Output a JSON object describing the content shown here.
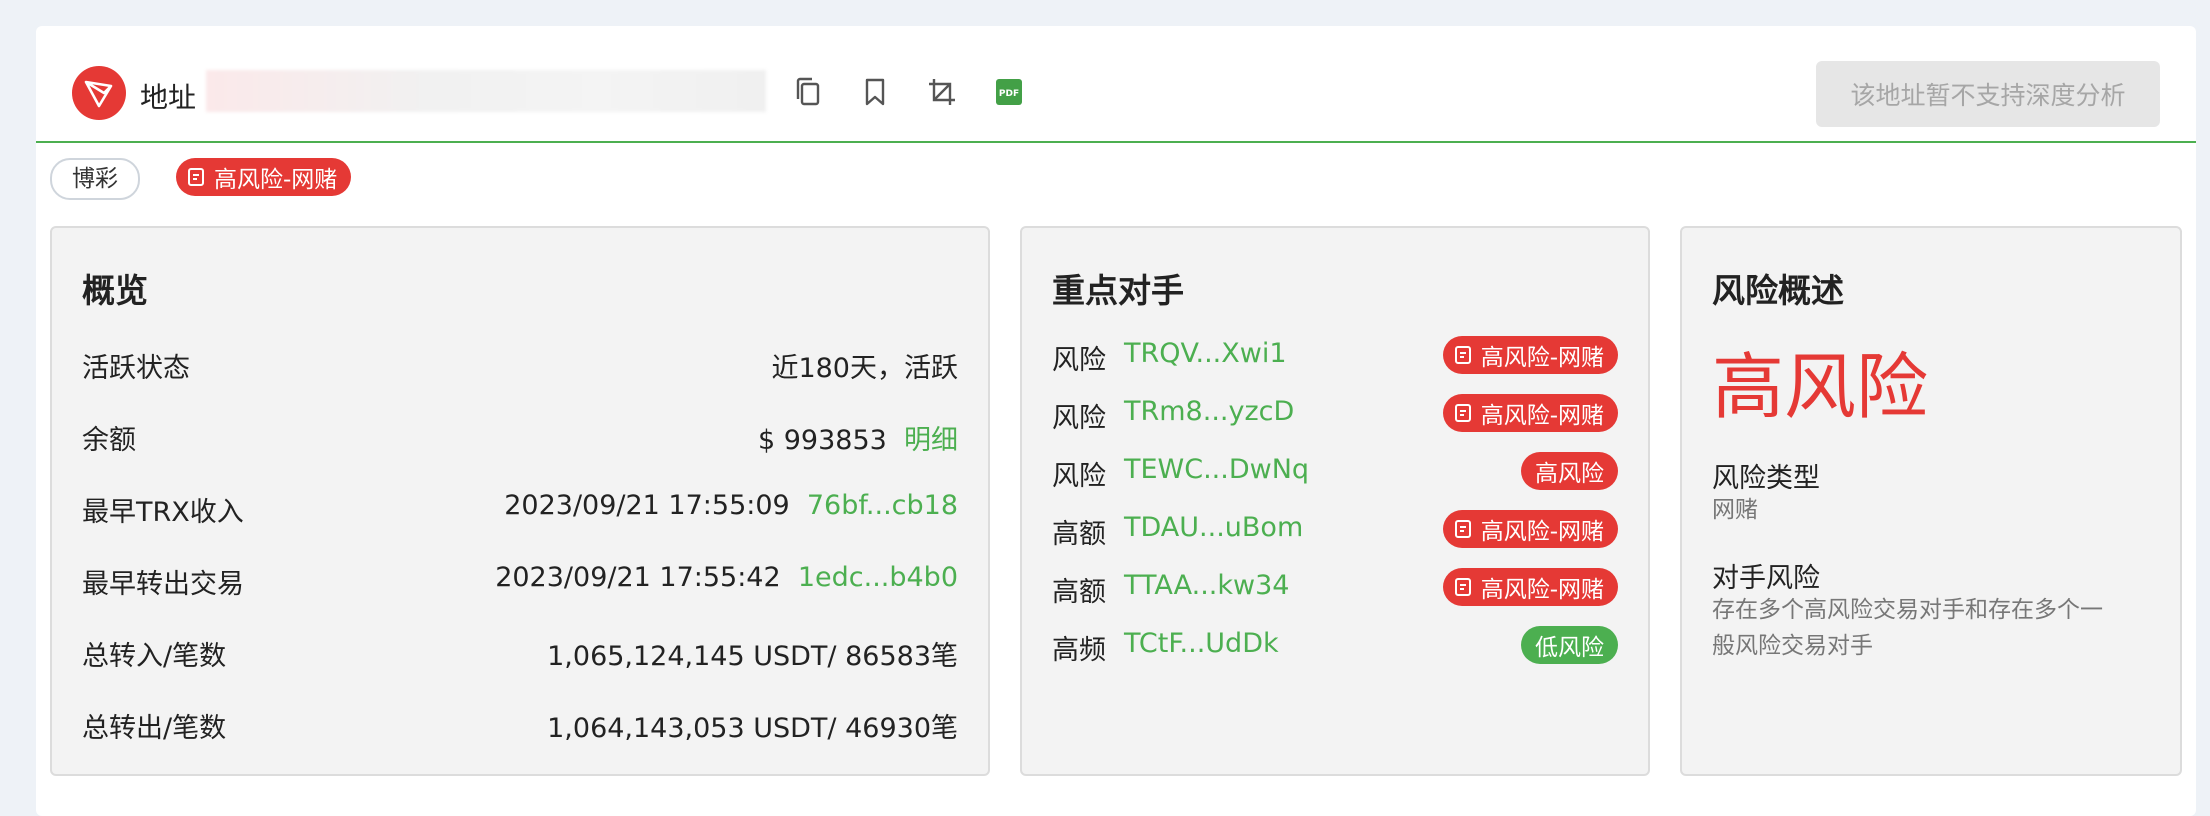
{
  "header": {
    "address_label": "地址",
    "address_value": "",
    "deep_analysis_button": "该地址暂不支持深度分析",
    "tools": [
      "copy-icon",
      "bookmark-icon",
      "crop-icon",
      "pdf-icon"
    ],
    "pdf_label": "PDF"
  },
  "tags": {
    "category": "博彩",
    "risk": "高风险-网赌"
  },
  "overview": {
    "title": "概览",
    "rows": [
      {
        "label": "活跃状态",
        "value": "近180天，活跃",
        "link": ""
      },
      {
        "label": "余额",
        "value": "$ 993853",
        "link": "明细"
      },
      {
        "label": "最早TRX收入",
        "value": "2023/09/21 17:55:09",
        "link": "76bf...cb18"
      },
      {
        "label": "最早转出交易",
        "value": "2023/09/21 17:55:42",
        "link": "1edc...b4b0"
      },
      {
        "label": "总转入/笔数",
        "value": "1,065,124,145 USDT/ 86583笔",
        "link": ""
      },
      {
        "label": "总转出/笔数",
        "value": "1,064,143,053 USDT/ 46930笔",
        "link": ""
      }
    ]
  },
  "counterparties": {
    "title": "重点对手",
    "items": [
      {
        "category": "风险",
        "address": "TRQV...Xwi1",
        "badge": "高风险-网赌",
        "level": "high"
      },
      {
        "category": "风险",
        "address": "TRm8...yzcD",
        "badge": "高风险-网赌",
        "level": "high"
      },
      {
        "category": "风险",
        "address": "TEWC...DwNq",
        "badge": "高风险",
        "level": "high-plain"
      },
      {
        "category": "高额",
        "address": "TDAU...uBom",
        "badge": "高风险-网赌",
        "level": "high"
      },
      {
        "category": "高额",
        "address": "TTAA...kw34",
        "badge": "高风险-网赌",
        "level": "high"
      },
      {
        "category": "高频",
        "address": "TCtF...UdDk",
        "badge": "低风险",
        "level": "low"
      }
    ]
  },
  "risk_summary": {
    "title": "风险概述",
    "level": "高风险",
    "type_label": "风险类型",
    "type_value": "网赌",
    "counterparty_label": "对手风险",
    "counterparty_value_line1": "存在多个高风险交易对手和存在多个一",
    "counterparty_value_line2": "般风险交易对手"
  },
  "colors": {
    "accent_green": "#4caf50",
    "risk_red": "#e53935",
    "panel_bg": "#f3f3f3"
  }
}
